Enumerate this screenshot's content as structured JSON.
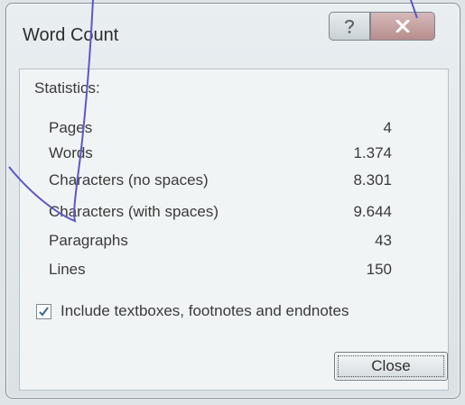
{
  "window": {
    "title": "Word Count",
    "help_icon": "help-icon",
    "close_icon": "close-icon"
  },
  "statistics": {
    "label": "Statistics:",
    "rows": [
      {
        "label": "Pages",
        "value": "4"
      },
      {
        "label": "Words",
        "value": "1.374"
      },
      {
        "label": "Characters (no spaces)",
        "value": "8.301"
      },
      {
        "label": "Characters (with spaces)",
        "value": "9.644"
      },
      {
        "label": "Paragraphs",
        "value": "43"
      },
      {
        "label": "Lines",
        "value": "150"
      }
    ]
  },
  "options": {
    "include_checkbox_label": "Include textboxes, footnotes and endnotes",
    "include_checked": true
  },
  "buttons": {
    "close_label": "Close"
  },
  "colors": {
    "ink": "#5b57c8",
    "close_button_tint": "#b78d8d"
  }
}
